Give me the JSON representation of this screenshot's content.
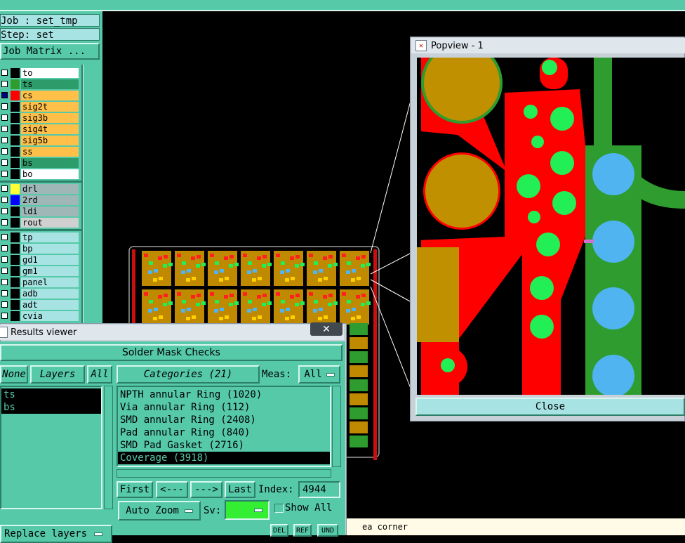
{
  "job": {
    "job_line": "Job : set_tmp",
    "step_line": "Step: set",
    "matrix_button": "Job Matrix ..."
  },
  "layers": {
    "group1": [
      {
        "name": "to",
        "color": "#ffffff",
        "swatch": "#000000"
      },
      {
        "name": "ts",
        "color": "#2e9c6a",
        "swatch": "#2e9c2e"
      },
      {
        "name": "cs",
        "color": "#ffc04a",
        "swatch": "#ff0000",
        "checkbox": "#000080"
      },
      {
        "name": "sig2t",
        "color": "#ffc04a",
        "swatch": "#000000"
      },
      {
        "name": "sig3b",
        "color": "#ffc04a",
        "swatch": "#000000"
      },
      {
        "name": "sig4t",
        "color": "#ffc04a",
        "swatch": "#000000"
      },
      {
        "name": "sig5b",
        "color": "#ffc04a",
        "swatch": "#000000"
      },
      {
        "name": "ss",
        "color": "#ffc04a",
        "swatch": "#000000"
      },
      {
        "name": "bs",
        "color": "#2e9c6a",
        "swatch": "#000000"
      },
      {
        "name": "bo",
        "color": "#ffffff",
        "swatch": "#000000"
      }
    ],
    "group2": [
      {
        "name": "drl",
        "color": "#9fb7b7",
        "swatch": "#ffff33"
      },
      {
        "name": "2rd",
        "color": "#9fb7b7",
        "swatch": "#0000ff"
      },
      {
        "name": "ldi",
        "color": "#9fb7b7",
        "swatch": "#000000"
      },
      {
        "name": "rout",
        "color": "#d0d0d0",
        "swatch": "#000000"
      }
    ],
    "group3": [
      {
        "name": "tp",
        "color": "#a7e3e3",
        "swatch": "#000000"
      },
      {
        "name": "bp",
        "color": "#a7e3e3",
        "swatch": "#000000"
      },
      {
        "name": "gd1",
        "color": "#a7e3e3",
        "swatch": "#000000"
      },
      {
        "name": "gm1",
        "color": "#a7e3e3",
        "swatch": "#000000"
      },
      {
        "name": "panel",
        "color": "#a7e3e3",
        "swatch": "#000000"
      },
      {
        "name": "adb",
        "color": "#a7e3e3",
        "swatch": "#000000"
      },
      {
        "name": "adt",
        "color": "#a7e3e3",
        "swatch": "#000000"
      },
      {
        "name": "cvia",
        "color": "#a7e3e3",
        "swatch": "#000000"
      }
    ]
  },
  "results_viewer": {
    "title": "Results viewer",
    "section": "Solder Mask Checks",
    "none_btn": "None",
    "layers_btn": "Layers",
    "all_btn": "All",
    "categories_btn": "Categories (21)",
    "meas_label": "Meas:",
    "meas_value": "All",
    "layer_list": [
      "ts",
      "bs"
    ],
    "categories": [
      "NPTH annular Ring (1020)",
      "Via annular Ring (112)",
      "SMD annular Ring (2408)",
      "Pad annular Ring (840)",
      "SMD Pad Gasket (2716)",
      "Coverage (3918)"
    ],
    "selected_category": 5,
    "first_btn": "First",
    "prev_btn": "<---",
    "next_btn": "--->",
    "last_btn": "Last",
    "index_label": "Index:",
    "index_value": "4944",
    "auto_zoom": "Auto Zoom",
    "sv_label": "Sv:",
    "show_all": "Show All",
    "replace_layers": "Replace layers",
    "del_btn": "DEL",
    "ref_btn": "REF",
    "undo_btn": "UND"
  },
  "status_text": "ea corner",
  "popview": {
    "title": "Popview - 1",
    "close_btn": "Close"
  },
  "icons": {
    "close": "close-icon",
    "dropdown": "dropdown-arrow-icon",
    "window": "window-icon"
  }
}
